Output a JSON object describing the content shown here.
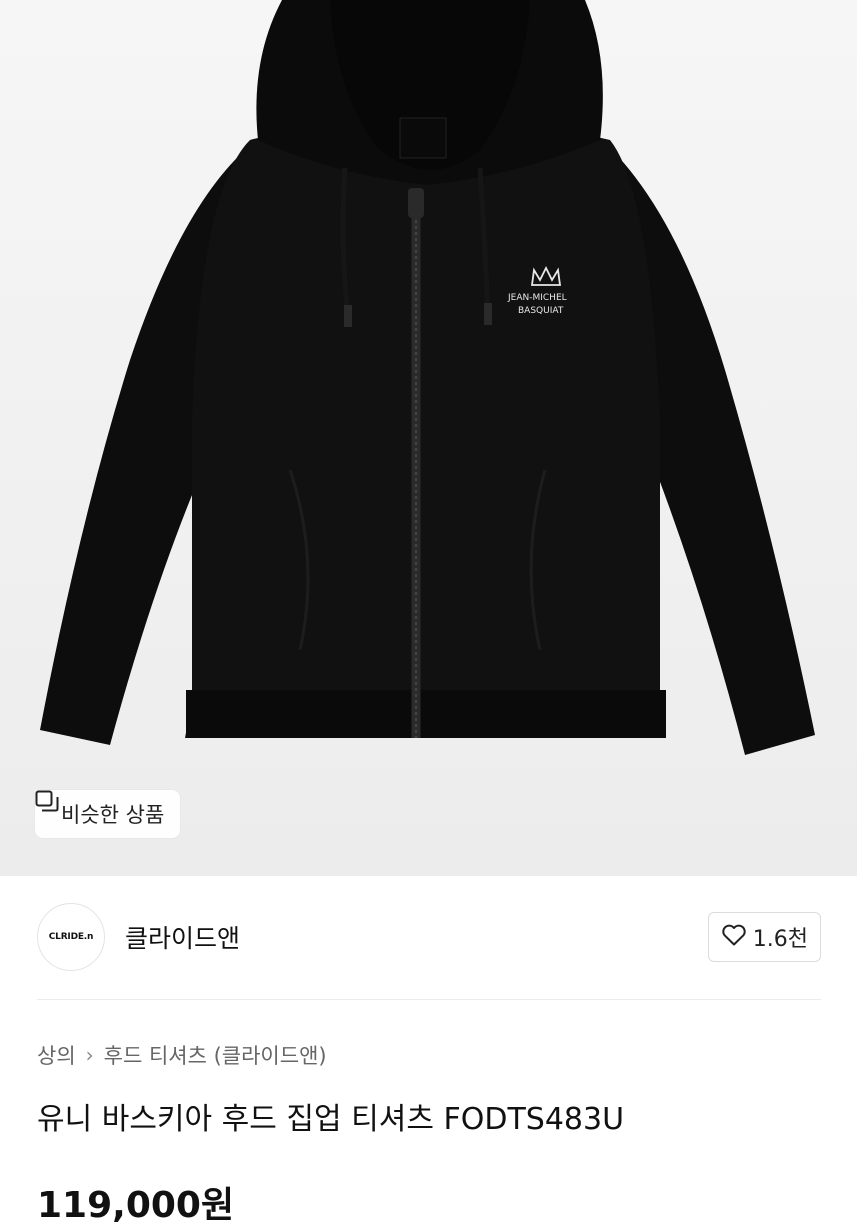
{
  "product_image": {
    "logo_text_line1": "JEAN-MICHEL",
    "logo_text_line2": "BASQUIAT"
  },
  "similar_button": {
    "label": "비슷한 상품",
    "icon": "similar-items-icon"
  },
  "brand": {
    "logo_text": "CLRIDE.n",
    "name": "클라이드앤",
    "like_count": "1.6천",
    "like_icon": "heart-outline-icon"
  },
  "breadcrumb": {
    "category": "상의",
    "subcategory": "후드 티셔츠 (클라이드앤)"
  },
  "product": {
    "title": "유니 바스키아 후드 집업 티셔츠 FODTS483U",
    "price": "119,000원"
  },
  "colors": {
    "hero_bg": "#efefef",
    "garment": "#0d0d0d"
  }
}
